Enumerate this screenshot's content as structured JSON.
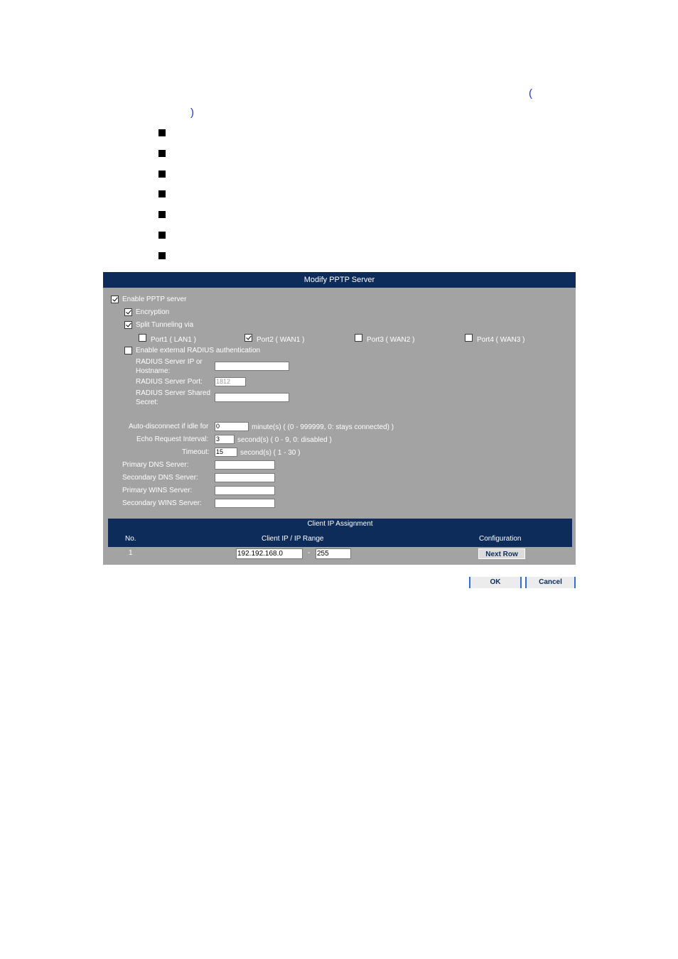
{
  "page": {
    "paren_open": "(",
    "paren_close": ")"
  },
  "panel": {
    "title": "Modify PPTP Server",
    "enable_pptp": {
      "label": "Enable PPTP server",
      "checked": true
    },
    "encryption": {
      "label": "Encryption",
      "checked": true
    },
    "split_tunneling": {
      "label": "Split Tunneling via",
      "checked": true
    },
    "ports": [
      {
        "label": "Port1 ( LAN1 )",
        "checked": false
      },
      {
        "label": "Port2 ( WAN1 )",
        "checked": true
      },
      {
        "label": "Port3 ( WAN2 )",
        "checked": false
      },
      {
        "label": "Port4 ( WAN3 )",
        "checked": false
      }
    ],
    "radius": {
      "label": "Enable external RADIUS authentication",
      "checked": false,
      "server_ip_label_1": "RADIUS Server IP or",
      "server_ip_label_2": "Hostname:",
      "server_ip_value": "",
      "port_label": "RADIUS Server Port:",
      "port_value": "1812",
      "secret_label_1": "RADIUS Server Shared",
      "secret_label_2": "Secret:",
      "secret_value": ""
    },
    "auto_disconnect": {
      "label": "Auto-disconnect if idle for",
      "value": "0",
      "hint": "minute(s) ( (0 - 999999, 0: stays connected) )"
    },
    "echo_interval": {
      "label": "Echo Request Interval:",
      "value": "3",
      "hint": "second(s) ( 0 - 9, 0: disabled )"
    },
    "timeout": {
      "label": "Timeout:",
      "value": "15",
      "hint": "second(s) ( 1 - 30 )"
    },
    "primary_dns": {
      "label": "Primary DNS Server:",
      "value": ""
    },
    "secondary_dns": {
      "label": "Secondary DNS Server:",
      "value": ""
    },
    "primary_wins": {
      "label": "Primary WINS Server:",
      "value": ""
    },
    "secondary_wins": {
      "label": "Secondary WINS Server:",
      "value": ""
    }
  },
  "client_ip": {
    "title": "Client IP Assignment",
    "headers": {
      "no": "No.",
      "range": "Client IP / IP Range",
      "config": "Configuration"
    },
    "rows": [
      {
        "no": "1",
        "start": "192.192.168.0",
        "sep": "-",
        "end": "255",
        "action": "Next Row"
      }
    ]
  },
  "buttons": {
    "ok": "OK",
    "cancel": "Cancel"
  }
}
